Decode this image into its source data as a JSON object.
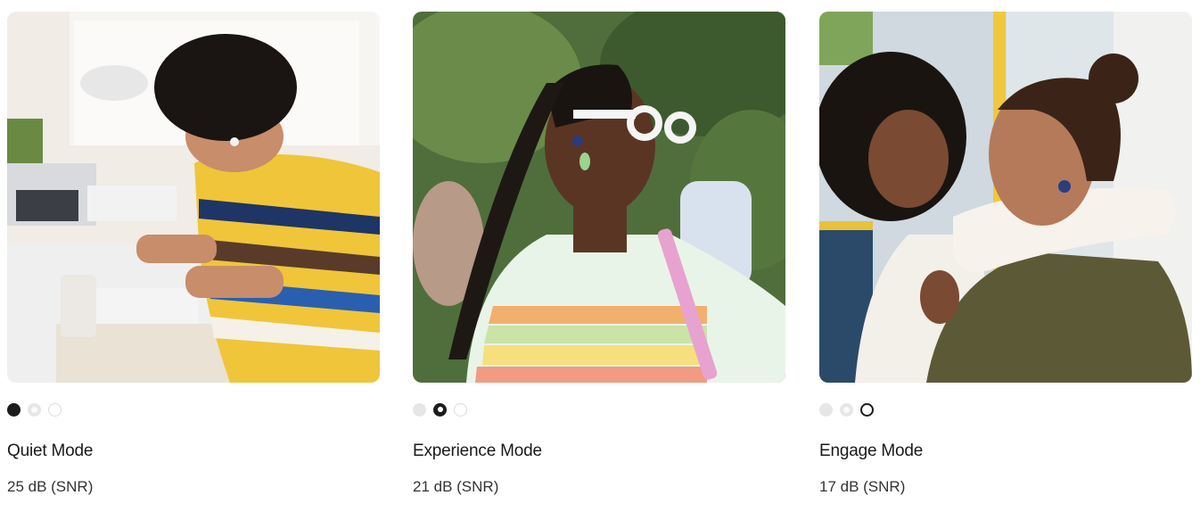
{
  "cards": [
    {
      "title": "Quiet Mode",
      "spec": "25 dB (SNR)",
      "photo_icon": "person-working-at-desk-image",
      "active_dot": 1
    },
    {
      "title": "Experience Mode",
      "spec": "21 dB (SNR)",
      "photo_icon": "woman-with-braids-outdoors-image",
      "active_dot": 2
    },
    {
      "title": "Engage Mode",
      "spec": "17 dB (SNR)",
      "photo_icon": "two-friends-laughing-image",
      "active_dot": 3
    }
  ],
  "colors": {
    "text": "#1a1a1a",
    "dot_active": "#1c1c1c",
    "dot_inactive": "#e6e6e6"
  }
}
